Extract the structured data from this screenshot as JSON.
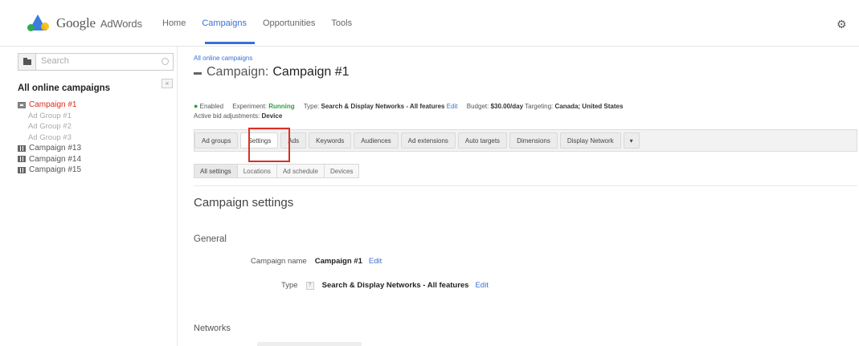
{
  "header": {
    "logo_google": "Google",
    "logo_adwords": "AdWords",
    "nav": [
      "Home",
      "Campaigns",
      "Opportunities",
      "Tools"
    ],
    "active_nav": "Campaigns"
  },
  "sidebar": {
    "search_placeholder": "Search",
    "title": "All online campaigns",
    "tree": [
      {
        "label": "Campaign #1",
        "type": "campaign",
        "state": "active"
      },
      {
        "label": "Ad Group #1",
        "type": "adgroup"
      },
      {
        "label": "Ad Group #2",
        "type": "adgroup"
      },
      {
        "label": "Ad Group #3",
        "type": "adgroup"
      },
      {
        "label": "Campaign #13",
        "type": "campaign"
      },
      {
        "label": "Campaign #14",
        "type": "campaign"
      },
      {
        "label": "Campaign #15",
        "type": "campaign"
      }
    ]
  },
  "main": {
    "breadcrumb": "All online campaigns",
    "title_prefix": "Campaign:",
    "title_name": "Campaign #1",
    "status": {
      "enabled": "Enabled",
      "experiment_label": "Experiment:",
      "experiment_value": "Running",
      "type_label": "Type:",
      "type_value": "Search & Display Networks - All features",
      "edit": "Edit",
      "budget_label": "Budget:",
      "budget_value": "$30.00/day",
      "targeting_label": "Targeting:",
      "targeting_value": "Canada; United States"
    },
    "bid_label": "Active bid adjustments:",
    "bid_value": "Device",
    "tabs": [
      "Ad groups",
      "Settings",
      "Ads",
      "Keywords",
      "Audiences",
      "Ad extensions",
      "Auto targets",
      "Dimensions",
      "Display Network",
      "▾"
    ],
    "selected_tab": "Settings",
    "subtabs": [
      "All settings",
      "Locations",
      "Ad schedule",
      "Devices"
    ],
    "section_title": "Campaign settings",
    "general_heading": "General",
    "campaign_name_label": "Campaign name",
    "campaign_name_value": "Campaign #1",
    "campaign_name_edit": "Edit",
    "type_label": "Type",
    "type_help": "?",
    "type_value": "Search & Display Networks - All features",
    "type_edit": "Edit",
    "networks_heading": "Networks"
  }
}
